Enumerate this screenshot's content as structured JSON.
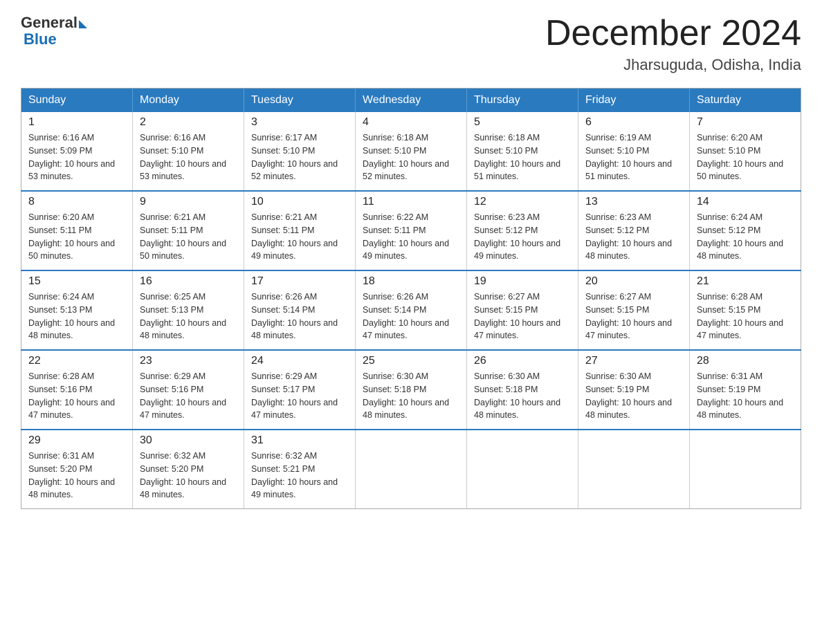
{
  "logo": {
    "general": "General",
    "blue": "Blue"
  },
  "title": "December 2024",
  "location": "Jharsuguda, Odisha, India",
  "weekdays": [
    "Sunday",
    "Monday",
    "Tuesday",
    "Wednesday",
    "Thursday",
    "Friday",
    "Saturday"
  ],
  "weeks": [
    [
      {
        "day": "1",
        "sunrise": "6:16 AM",
        "sunset": "5:09 PM",
        "daylight": "10 hours and 53 minutes."
      },
      {
        "day": "2",
        "sunrise": "6:16 AM",
        "sunset": "5:10 PM",
        "daylight": "10 hours and 53 minutes."
      },
      {
        "day": "3",
        "sunrise": "6:17 AM",
        "sunset": "5:10 PM",
        "daylight": "10 hours and 52 minutes."
      },
      {
        "day": "4",
        "sunrise": "6:18 AM",
        "sunset": "5:10 PM",
        "daylight": "10 hours and 52 minutes."
      },
      {
        "day": "5",
        "sunrise": "6:18 AM",
        "sunset": "5:10 PM",
        "daylight": "10 hours and 51 minutes."
      },
      {
        "day": "6",
        "sunrise": "6:19 AM",
        "sunset": "5:10 PM",
        "daylight": "10 hours and 51 minutes."
      },
      {
        "day": "7",
        "sunrise": "6:20 AM",
        "sunset": "5:10 PM",
        "daylight": "10 hours and 50 minutes."
      }
    ],
    [
      {
        "day": "8",
        "sunrise": "6:20 AM",
        "sunset": "5:11 PM",
        "daylight": "10 hours and 50 minutes."
      },
      {
        "day": "9",
        "sunrise": "6:21 AM",
        "sunset": "5:11 PM",
        "daylight": "10 hours and 50 minutes."
      },
      {
        "day": "10",
        "sunrise": "6:21 AM",
        "sunset": "5:11 PM",
        "daylight": "10 hours and 49 minutes."
      },
      {
        "day": "11",
        "sunrise": "6:22 AM",
        "sunset": "5:11 PM",
        "daylight": "10 hours and 49 minutes."
      },
      {
        "day": "12",
        "sunrise": "6:23 AM",
        "sunset": "5:12 PM",
        "daylight": "10 hours and 49 minutes."
      },
      {
        "day": "13",
        "sunrise": "6:23 AM",
        "sunset": "5:12 PM",
        "daylight": "10 hours and 48 minutes."
      },
      {
        "day": "14",
        "sunrise": "6:24 AM",
        "sunset": "5:12 PM",
        "daylight": "10 hours and 48 minutes."
      }
    ],
    [
      {
        "day": "15",
        "sunrise": "6:24 AM",
        "sunset": "5:13 PM",
        "daylight": "10 hours and 48 minutes."
      },
      {
        "day": "16",
        "sunrise": "6:25 AM",
        "sunset": "5:13 PM",
        "daylight": "10 hours and 48 minutes."
      },
      {
        "day": "17",
        "sunrise": "6:26 AM",
        "sunset": "5:14 PM",
        "daylight": "10 hours and 48 minutes."
      },
      {
        "day": "18",
        "sunrise": "6:26 AM",
        "sunset": "5:14 PM",
        "daylight": "10 hours and 47 minutes."
      },
      {
        "day": "19",
        "sunrise": "6:27 AM",
        "sunset": "5:15 PM",
        "daylight": "10 hours and 47 minutes."
      },
      {
        "day": "20",
        "sunrise": "6:27 AM",
        "sunset": "5:15 PM",
        "daylight": "10 hours and 47 minutes."
      },
      {
        "day": "21",
        "sunrise": "6:28 AM",
        "sunset": "5:15 PM",
        "daylight": "10 hours and 47 minutes."
      }
    ],
    [
      {
        "day": "22",
        "sunrise": "6:28 AM",
        "sunset": "5:16 PM",
        "daylight": "10 hours and 47 minutes."
      },
      {
        "day": "23",
        "sunrise": "6:29 AM",
        "sunset": "5:16 PM",
        "daylight": "10 hours and 47 minutes."
      },
      {
        "day": "24",
        "sunrise": "6:29 AM",
        "sunset": "5:17 PM",
        "daylight": "10 hours and 47 minutes."
      },
      {
        "day": "25",
        "sunrise": "6:30 AM",
        "sunset": "5:18 PM",
        "daylight": "10 hours and 48 minutes."
      },
      {
        "day": "26",
        "sunrise": "6:30 AM",
        "sunset": "5:18 PM",
        "daylight": "10 hours and 48 minutes."
      },
      {
        "day": "27",
        "sunrise": "6:30 AM",
        "sunset": "5:19 PM",
        "daylight": "10 hours and 48 minutes."
      },
      {
        "day": "28",
        "sunrise": "6:31 AM",
        "sunset": "5:19 PM",
        "daylight": "10 hours and 48 minutes."
      }
    ],
    [
      {
        "day": "29",
        "sunrise": "6:31 AM",
        "sunset": "5:20 PM",
        "daylight": "10 hours and 48 minutes."
      },
      {
        "day": "30",
        "sunrise": "6:32 AM",
        "sunset": "5:20 PM",
        "daylight": "10 hours and 48 minutes."
      },
      {
        "day": "31",
        "sunrise": "6:32 AM",
        "sunset": "5:21 PM",
        "daylight": "10 hours and 49 minutes."
      },
      null,
      null,
      null,
      null
    ]
  ]
}
